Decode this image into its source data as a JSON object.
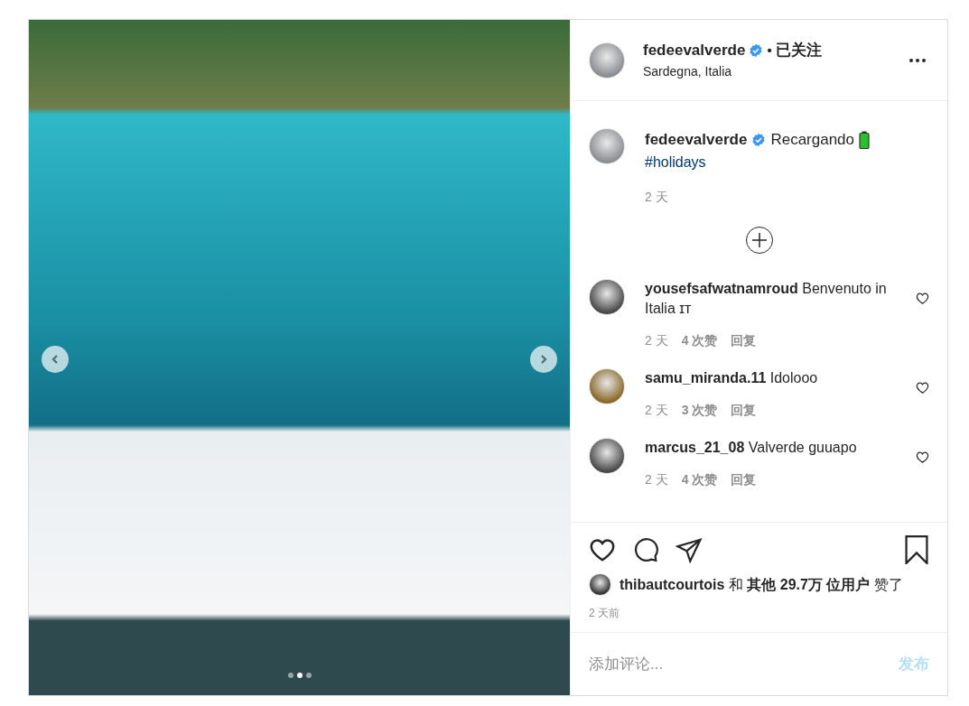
{
  "post": {
    "carousel": {
      "dots": [
        {
          "selected": false
        },
        {
          "selected": true
        },
        {
          "selected": false
        }
      ]
    }
  },
  "header": {
    "username": "fedeevalverde",
    "separator": "•",
    "follow": "已关注",
    "location": "Sardegna, Italia"
  },
  "caption": {
    "username": "fedeevalverde",
    "text": "Recargando",
    "hashtag": "#holidays",
    "time": "2 天"
  },
  "comments": [
    {
      "username": "yousefsafwatnamroud",
      "text": "Benvenuto in Italia ɪᴛ",
      "time": "2 天",
      "likes": "4 次赞",
      "reply": "回复"
    },
    {
      "username": "samu_miranda.11",
      "text": "Idolooo",
      "time": "2 天",
      "likes": "3 次赞",
      "reply": "回复"
    },
    {
      "username": "marcus_21_08",
      "text": "Valverde guuapo",
      "time": "2 天",
      "likes": "4 次赞",
      "reply": "回复"
    }
  ],
  "liked_by": {
    "text": "**thibautcourtois** 和 **其他 29.7万 位用户** 赞了"
  },
  "posted": "2 天前",
  "comment_input": {
    "placeholder": "添加评论...",
    "submit": "发布"
  }
}
